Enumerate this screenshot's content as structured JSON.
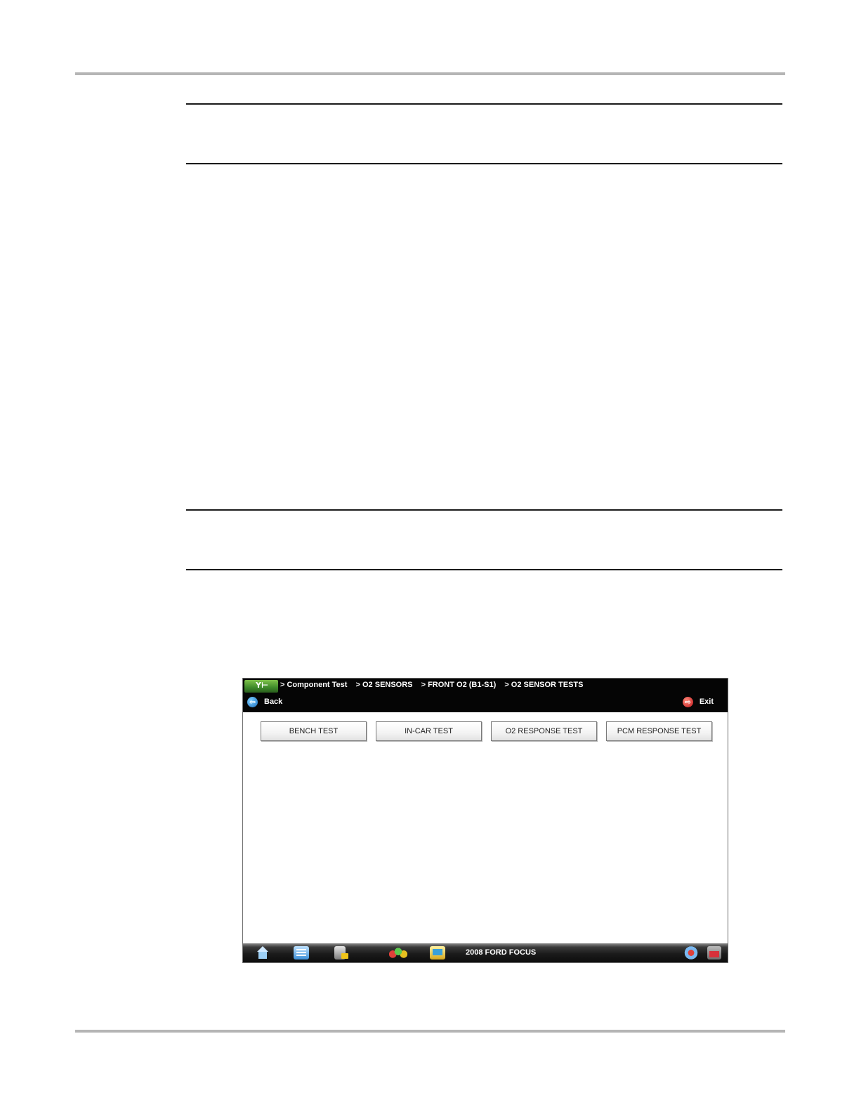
{
  "screen": {
    "breadcrumb": [
      "> Component Test",
      "> O2 SENSORS",
      "> FRONT O2 (B1-S1)",
      "> O2 SENSOR TESTS"
    ],
    "back_label": "Back",
    "exit_label": "Exit",
    "tests": {
      "bench": "BENCH TEST",
      "incar": "IN-CAR TEST",
      "o2_response": "O2 RESPONSE TEST",
      "pcm_response": "PCM RESPONSE TEST"
    },
    "toolbar": {
      "vehicle": "2008 FORD FOCUS",
      "icons": [
        "home-icon",
        "list-icon",
        "tools-icon",
        "people-icon",
        "data-icon",
        "connect-icon",
        "battery-icon"
      ]
    },
    "colors": {
      "header_bg": "#050505",
      "logo_green": "#3e8a2a",
      "back_blue": "#1a6fc0",
      "exit_red": "#c0151a"
    }
  }
}
